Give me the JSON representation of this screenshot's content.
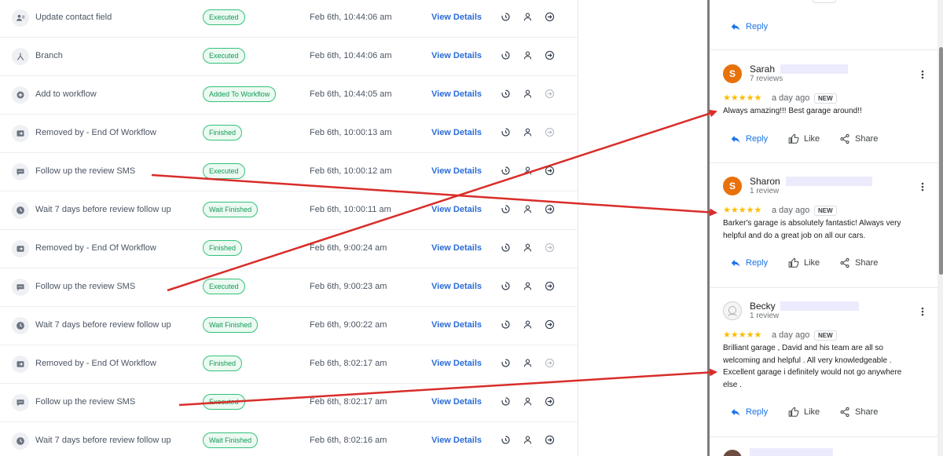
{
  "log": {
    "view_details_label": "View Details",
    "rows": [
      {
        "icon": "contact-icon",
        "name": "Update contact field",
        "status": "Executed",
        "time": "Feb 6th, 10:44:06 am"
      },
      {
        "icon": "branch-icon",
        "name": "Branch",
        "status": "Executed",
        "time": "Feb 6th, 10:44:06 am"
      },
      {
        "icon": "add-icon",
        "name": "Add to workflow",
        "status": "Added To Workflow",
        "time": "Feb 6th, 10:44:05 am"
      },
      {
        "icon": "exit-icon",
        "name": "Removed by - End Of Workflow",
        "status": "Finished",
        "time": "Feb 6th, 10:00:13 am"
      },
      {
        "icon": "sms-icon",
        "name": "Follow up the review SMS",
        "status": "Executed",
        "time": "Feb 6th, 10:00:12 am"
      },
      {
        "icon": "clock-icon",
        "name": "Wait 7 days before review follow up",
        "status": "Wait Finished",
        "time": "Feb 6th, 10:00:11 am"
      },
      {
        "icon": "exit-icon",
        "name": "Removed by - End Of Workflow",
        "status": "Finished",
        "time": "Feb 6th, 9:00:24 am"
      },
      {
        "icon": "sms-icon",
        "name": "Follow up the review SMS",
        "status": "Executed",
        "time": "Feb 6th, 9:00:23 am"
      },
      {
        "icon": "clock-icon",
        "name": "Wait 7 days before review follow up",
        "status": "Wait Finished",
        "time": "Feb 6th, 9:00:22 am"
      },
      {
        "icon": "exit-icon",
        "name": "Removed by - End Of Workflow",
        "status": "Finished",
        "time": "Feb 6th, 8:02:17 am"
      },
      {
        "icon": "sms-icon",
        "name": "Follow up the review SMS",
        "status": "Executed",
        "time": "Feb 6th, 8:02:17 am"
      },
      {
        "icon": "clock-icon",
        "name": "Wait 7 days before review follow up",
        "status": "Wait Finished",
        "time": "Feb 6th, 8:02:16 am"
      }
    ]
  },
  "reviews": {
    "reply_label": "Reply",
    "like_label": "Like",
    "share_label": "Share",
    "new_label": "NEW",
    "stars": "★★★★★",
    "cards": [
      {
        "initial": "S",
        "avatar_color": "#e8710a",
        "name": "Sarah",
        "count": "7 reviews",
        "ago": "a day ago",
        "lines": [
          "Always amazing!!! Best garage around!!"
        ]
      },
      {
        "initial": "S",
        "avatar_color": "#e8710a",
        "name": "Sharon",
        "count": "1 review",
        "ago": "a day ago",
        "lines": [
          "Barker's garage is absolutely fantastic! Always very",
          "helpful and do a great job on all our cars."
        ]
      },
      {
        "initial": "",
        "avatar_color": "#f1f3f4",
        "name": "Becky",
        "count": "1 review",
        "ago": "a day ago",
        "lines": [
          "Brilliant garage , David and his team are all so",
          "welcoming and helpful . All very knowledgeable .",
          "Excellent garage i definitely would not go anywhere",
          "else ."
        ]
      }
    ]
  },
  "colors": {
    "arrow": "#d92d2a",
    "badge_green": "#139a57",
    "link_blue": "#2b6cd8"
  }
}
